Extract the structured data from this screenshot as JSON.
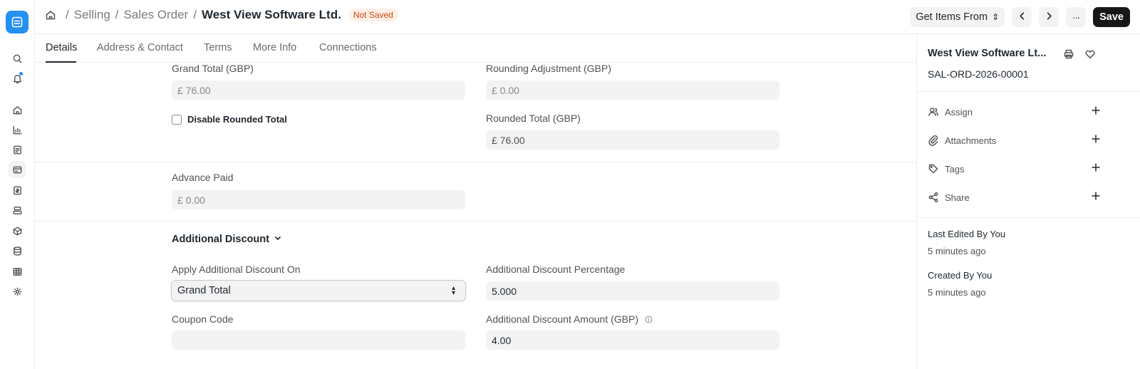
{
  "breadcrumb": {
    "items": [
      "Selling",
      "Sales Order"
    ],
    "separator": "/",
    "title": "West View Software Ltd.",
    "status_badge": "Not Saved"
  },
  "header_actions": {
    "get_items_label": "Get Items From",
    "get_items_indicator": "⇕",
    "more_label": "···",
    "save_label": "Save"
  },
  "tabs": [
    {
      "label": "Details",
      "active": true
    },
    {
      "label": "Address & Contact",
      "active": false
    },
    {
      "label": "Terms",
      "active": false
    },
    {
      "label": "More Info",
      "active": false
    },
    {
      "label": "Connections",
      "active": false
    }
  ],
  "form": {
    "grand_total": {
      "label": "Grand Total (GBP)",
      "value": "£ 76.00"
    },
    "rounding_adjustment": {
      "label": "Rounding Adjustment (GBP)",
      "value": "£ 0.00"
    },
    "disable_rounded_total": {
      "label": "Disable Rounded Total",
      "checked": false
    },
    "rounded_total": {
      "label": "Rounded Total (GBP)",
      "value": "£ 76.00"
    },
    "advance_paid": {
      "label": "Advance Paid",
      "value": "£ 0.00"
    },
    "additional_discount_section": "Additional Discount",
    "apply_discount_on": {
      "label": "Apply Additional Discount On",
      "value": "Grand Total"
    },
    "discount_percentage": {
      "label": "Additional Discount Percentage",
      "value": "5.000"
    },
    "coupon_code": {
      "label": "Coupon Code",
      "value": ""
    },
    "discount_amount": {
      "label": "Additional Discount Amount (GBP)",
      "value": "4.00"
    }
  },
  "sidebar": {
    "doc_title": "West View Software Lt...",
    "doc_id": "SAL-ORD-2026-00001",
    "actions": [
      {
        "label": "Assign",
        "icon": "user-icon"
      },
      {
        "label": "Attachments",
        "icon": "paperclip-icon"
      },
      {
        "label": "Tags",
        "icon": "tag-icon"
      },
      {
        "label": "Share",
        "icon": "share-icon"
      }
    ],
    "last_edited_by": "Last Edited By You",
    "last_edited_time": "5 minutes ago",
    "created_by": "Created By You",
    "created_time": "5 minutes ago"
  },
  "colors": {
    "accent": "#2490ef",
    "badge_bg": "#fff0e6",
    "badge_text": "#c4480d",
    "save_bg": "#171717"
  }
}
